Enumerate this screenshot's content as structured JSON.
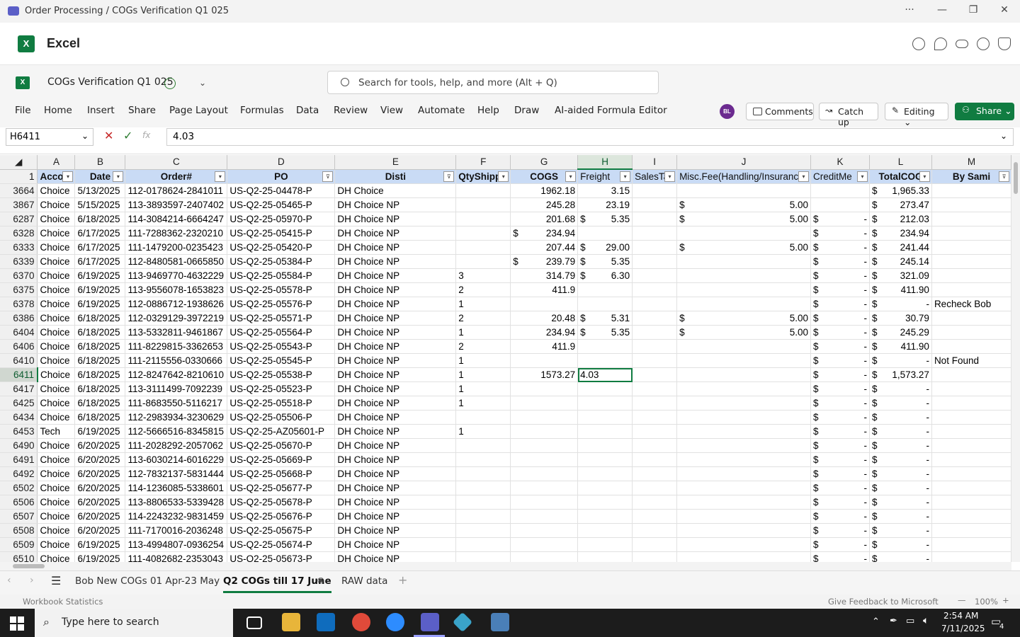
{
  "window": {
    "title": "Order Processing / COGs Verification Q1 025",
    "min": "—",
    "max": "❐",
    "close": "✕",
    "more": "···"
  },
  "app": {
    "name": "Excel"
  },
  "doc": {
    "title": "COGs Verification Q1 025",
    "search_placeholder": "Search for tools, help, and more (Alt + Q)"
  },
  "menu": [
    "File",
    "Home",
    "Insert",
    "Share",
    "Page Layout",
    "Formulas",
    "Data",
    "Review",
    "View",
    "Automate",
    "Help",
    "Draw",
    "AI-aided Formula Editor"
  ],
  "toolbar": {
    "avatar": "BL",
    "comments": "Comments",
    "catchup": "Catch up",
    "editing": "Editing",
    "share": "Share"
  },
  "formula_bar": {
    "cell": "H6411",
    "value": "4.03"
  },
  "columns": [
    "A",
    "B",
    "C",
    "D",
    "E",
    "F",
    "G",
    "H",
    "I",
    "J",
    "K",
    "L",
    "M"
  ],
  "headers": [
    "Accou",
    "Date",
    "Order#",
    "PO",
    "Disti",
    "QtyShipp",
    "COGS",
    "Freight",
    "SalesTa",
    "Misc.Fee(Handling/Insuranc",
    "CreditMe",
    "TotalCOG",
    "By Sami"
  ],
  "header_row": "1",
  "rows": [
    [
      "3664",
      "Choice",
      "5/13/2025",
      "112-0178624-2841011",
      "US-Q2-25-04478-P",
      "DH Choice",
      "",
      "1962.18",
      "3.15",
      "",
      "",
      "",
      "",
      "$",
      "1,965.33",
      ""
    ],
    [
      "3867",
      "Choice",
      "5/15/2025",
      "113-3893597-2407402",
      "US-Q2-25-05465-P",
      "DH Choice NP",
      "",
      "245.28",
      "23.19",
      "",
      "5.00",
      "",
      "",
      "$",
      "273.47",
      ""
    ],
    [
      "6287",
      "Choice",
      "6/18/2025",
      "114-3084214-6664247",
      "US-Q2-25-05970-P",
      "DH Choice NP",
      "",
      "201.68",
      "$ 5.35",
      "",
      "5.00",
      "$",
      "-",
      "$",
      "212.03",
      ""
    ],
    [
      "6328",
      "Choice",
      "6/17/2025",
      "111-7288362-2320210",
      "US-Q2-25-05415-P",
      "DH Choice NP",
      "",
      "$ 234.94",
      "",
      "",
      "",
      "$",
      "-",
      "$",
      "234.94",
      ""
    ],
    [
      "6333",
      "Choice",
      "6/17/2025",
      "111-1479200-0235423",
      "US-Q2-25-05420-P",
      "DH Choice NP",
      "",
      "207.44",
      "$ 29.00",
      "",
      "5.00",
      "$",
      "-",
      "$",
      "241.44",
      ""
    ],
    [
      "6339",
      "Choice",
      "6/17/2025",
      "112-8480581-0665850",
      "US-Q2-25-05384-P",
      "DH Choice NP",
      "",
      "$ 239.79",
      "$ 5.35",
      "",
      "",
      "$",
      "-",
      "$",
      "245.14",
      ""
    ],
    [
      "6370",
      "Choice",
      "6/19/2025",
      "113-9469770-4632229",
      "US-Q2-25-05584-P",
      "DH Choice NP",
      "3",
      "314.79",
      "$ 6.30",
      "",
      "",
      "$",
      "-",
      "$",
      "321.09",
      ""
    ],
    [
      "6375",
      "Choice",
      "6/19/2025",
      "113-9556078-1653823",
      "US-Q2-25-05578-P",
      "DH Choice NP",
      "2",
      "411.9",
      "",
      "",
      "",
      "$",
      "-",
      "$",
      "411.90",
      ""
    ],
    [
      "6378",
      "Choice",
      "6/19/2025",
      "112-0886712-1938626",
      "US-Q2-25-05576-P",
      "DH Choice NP",
      "1",
      "",
      "",
      "",
      "",
      "$",
      "-",
      "$",
      "-",
      "Recheck Bob"
    ],
    [
      "6386",
      "Choice",
      "6/18/2025",
      "112-0329129-3972219",
      "US-Q2-25-05571-P",
      "DH Choice NP",
      "2",
      "20.48",
      "$ 5.31",
      "",
      "5.00",
      "$",
      "-",
      "$",
      "30.79",
      ""
    ],
    [
      "6404",
      "Choice",
      "6/18/2025",
      "113-5332811-9461867",
      "US-Q2-25-05564-P",
      "DH Choice NP",
      "1",
      "234.94",
      "$ 5.35",
      "",
      "5.00",
      "$",
      "-",
      "$",
      "245.29",
      ""
    ],
    [
      "6406",
      "Choice",
      "6/18/2025",
      "111-8229815-3362653",
      "US-Q2-25-05543-P",
      "DH Choice NP",
      "2",
      "411.9",
      "",
      "",
      "",
      "$",
      "-",
      "$",
      "411.90",
      ""
    ],
    [
      "6410",
      "Choice",
      "6/18/2025",
      "111-2115556-0330666",
      "US-Q2-25-05545-P",
      "DH Choice NP",
      "1",
      "",
      "",
      "",
      "",
      "$",
      "-",
      "$",
      "-",
      "Not Found"
    ],
    [
      "6411",
      "Choice",
      "6/18/2025",
      "112-8247642-8210610",
      "US-Q2-25-05538-P",
      "DH Choice NP",
      "1",
      "1573.27",
      "4.03",
      "",
      "",
      "$",
      "-",
      "$",
      "1,573.27",
      ""
    ],
    [
      "6417",
      "Choice",
      "6/18/2025",
      "113-3111499-7092239",
      "US-Q2-25-05523-P",
      "DH Choice NP",
      "1",
      "",
      "",
      "",
      "",
      "$",
      "-",
      "$",
      "-",
      ""
    ],
    [
      "6425",
      "Choice",
      "6/18/2025",
      "111-8683550-5116217",
      "US-Q2-25-05518-P",
      "DH Choice NP",
      "1",
      "",
      "",
      "",
      "",
      "$",
      "-",
      "$",
      "-",
      ""
    ],
    [
      "6434",
      "Choice",
      "6/18/2025",
      "112-2983934-3230629",
      "US-Q2-25-05506-P",
      "DH Choice NP",
      "",
      "",
      "",
      "",
      "",
      "$",
      "-",
      "$",
      "-",
      ""
    ],
    [
      "6453",
      "Tech",
      "6/19/2025",
      "112-5666516-8345815",
      "US-Q2-25-AZ05601-P",
      "DH Choice NP",
      "1",
      "",
      "",
      "",
      "",
      "$",
      "-",
      "$",
      "-",
      ""
    ],
    [
      "6490",
      "Choice",
      "6/20/2025",
      "111-2028292-2057062",
      "US-Q2-25-05670-P",
      "DH Choice NP",
      "",
      "",
      "",
      "",
      "",
      "$",
      "-",
      "$",
      "-",
      ""
    ],
    [
      "6491",
      "Choice",
      "6/20/2025",
      "113-6030214-6016229",
      "US-Q2-25-05669-P",
      "DH Choice NP",
      "",
      "",
      "",
      "",
      "",
      "$",
      "-",
      "$",
      "-",
      ""
    ],
    [
      "6492",
      "Choice",
      "6/20/2025",
      "112-7832137-5831444",
      "US-Q2-25-05668-P",
      "DH Choice NP",
      "",
      "",
      "",
      "",
      "",
      "$",
      "-",
      "$",
      "-",
      ""
    ],
    [
      "6502",
      "Choice",
      "6/20/2025",
      "114-1236085-5338601",
      "US-Q2-25-05677-P",
      "DH Choice NP",
      "",
      "",
      "",
      "",
      "",
      "$",
      "-",
      "$",
      "-",
      ""
    ],
    [
      "6506",
      "Choice",
      "6/20/2025",
      "113-8806533-5339428",
      "US-Q2-25-05678-P",
      "DH Choice NP",
      "",
      "",
      "",
      "",
      "",
      "$",
      "-",
      "$",
      "-",
      ""
    ],
    [
      "6507",
      "Choice",
      "6/20/2025",
      "114-2243232-9831459",
      "US-Q2-25-05676-P",
      "DH Choice NP",
      "",
      "",
      "",
      "",
      "",
      "$",
      "-",
      "$",
      "-",
      ""
    ],
    [
      "6508",
      "Choice",
      "6/20/2025",
      "111-7170016-2036248",
      "US-Q2-25-05675-P",
      "DH Choice NP",
      "",
      "",
      "",
      "",
      "",
      "$",
      "-",
      "$",
      "-",
      ""
    ],
    [
      "6509",
      "Choice",
      "6/19/2025",
      "113-4994807-0936254",
      "US-Q2-25-05674-P",
      "DH Choice NP",
      "",
      "",
      "",
      "",
      "",
      "$",
      "-",
      "$",
      "-",
      ""
    ],
    [
      "6510",
      "Choice",
      "6/19/2025",
      "111-4082682-2353043",
      "US-Q2-25-05673-P",
      "DH Choice NP",
      "",
      "",
      "",
      "",
      "",
      "$",
      "-",
      "$",
      "-",
      ""
    ]
  ],
  "sheets": [
    "Bob New COGs 01 Apr-23 May",
    "Q2 COGs till 17 June",
    "RAW data"
  ],
  "active_sheet": "Q2 COGs till 17 June",
  "status": {
    "left": "Workbook Statistics",
    "feedback": "Give Feedback to Microsoft",
    "zoom": "100%"
  },
  "taskbar": {
    "search": "Type here to search",
    "time": "2:54 AM",
    "date": "7/11/2025",
    "notif": "4"
  },
  "colors": {
    "excel_green": "#107c41",
    "header_fill": "#c9dbf5",
    "taskbar": "#1c1c1c"
  }
}
